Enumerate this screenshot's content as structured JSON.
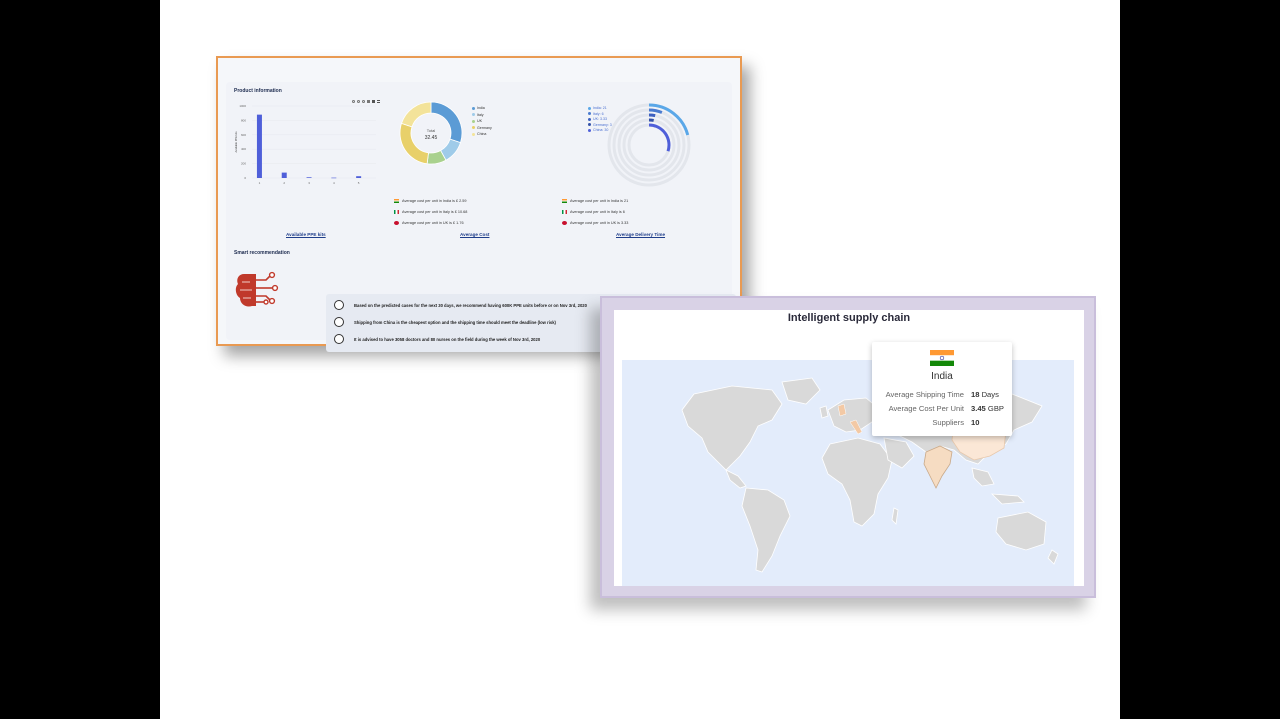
{
  "dashboard": {
    "product_info_title": "Product information",
    "smart_rec_title": "Smart recommendation",
    "bar_chart": {
      "ylabel": "Available PPE kits",
      "y_ticks": [
        "1000",
        "800",
        "600",
        "400",
        "200",
        "0"
      ],
      "x_ticks": [
        "1",
        "2",
        "3",
        "4",
        "5"
      ],
      "values": [
        880,
        75,
        10,
        5,
        25
      ]
    },
    "donut": {
      "center_label": "Total",
      "center_value": "32.45",
      "legend": [
        "India",
        "Italy",
        "UK",
        "Germany",
        "China"
      ],
      "colors": [
        "#5b9bd5",
        "#9fcbe9",
        "#a9d18e",
        "#e8d06a",
        "#f3e39a"
      ],
      "slices": [
        30,
        12,
        10,
        28,
        20
      ]
    },
    "radial": {
      "legend": [
        "India: 21",
        "Italy: 6",
        "UK: 3.33",
        "Germany: 3",
        "China: 30"
      ]
    },
    "avg_cost_lines": [
      "Average cost per unit in India is £ 2.59",
      "Average cost per unit in Italy is £ 10.68",
      "Average cost per unit in UK is £ 1.76"
    ],
    "delivery_lines": [
      "Average cost per unit in India is 21",
      "Average cost per unit in Italy is 6",
      "Average cost per unit in UK is 3.33"
    ],
    "links": {
      "ppe": "Available PPE kits",
      "cost": "Average Cost",
      "delivery": "Average Delivery Time"
    },
    "recommendations": [
      "Based on the predicted cases for the next 30 days, we recommend having 600K PPE units before or on Nov 3rd, 2020",
      "Shipping from China is the cheapest option and the shipping time should meet the deadline (low risk)",
      "It is advised to have 3058 doctors and 80 nurses on the field during the week of Nov 3rd, 2020"
    ],
    "toolbar_icons": [
      "zoom-in-icon",
      "zoom-out-icon",
      "search-icon",
      "pan-icon",
      "home-icon",
      "menu-icon"
    ]
  },
  "map": {
    "title": "Intelligent supply chain",
    "tooltip": {
      "country": "India",
      "rows": [
        {
          "label": "Average Shipping Time",
          "value": "18",
          "unit": "Days"
        },
        {
          "label": "Average Cost Per Unit",
          "value": "3.45",
          "unit": "GBP"
        },
        {
          "label": "Suppliers",
          "value": "10",
          "unit": ""
        }
      ]
    },
    "zoom_in": "+",
    "zoom_out": "−"
  }
}
